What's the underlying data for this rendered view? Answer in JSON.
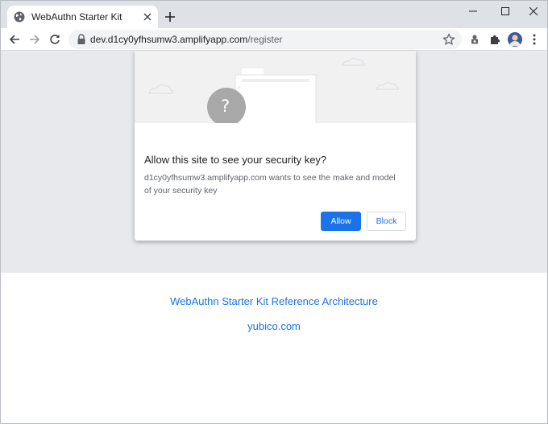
{
  "tab": {
    "title": "WebAuthn Starter Kit",
    "favicon": "globe-icon",
    "close_icon": "close-icon"
  },
  "new_tab_icon": "plus-icon",
  "window_controls": [
    "minimize-icon",
    "maximize-icon",
    "close-icon"
  ],
  "toolbar": {
    "back_icon": "arrow-left-icon",
    "forward_icon": "arrow-right-icon",
    "reload_icon": "reload-icon",
    "url_host": "dev.d1cy0yfhsumw3.amplifyapp.com",
    "url_path": "/register",
    "lock_icon": "lock-icon",
    "bookmark_icon": "star-icon",
    "extensions": [
      "puzzle-icon",
      "extension-icon"
    ],
    "menu_icon": "kebab-menu-icon"
  },
  "dialog": {
    "illustration_glyph": "?",
    "title": "Allow this site to see your security key?",
    "body": "d1cy0yfhsumw3.amplifyapp.com wants to see the make and model of your security key",
    "allow_label": "Allow",
    "block_label": "Block"
  },
  "footer": {
    "link1": "WebAuthn Starter Kit Reference Architecture",
    "link2": "yubico.com"
  },
  "colors": {
    "accent": "#1a73e8",
    "tabstrip": "#dee1e6",
    "page_band": "#e7e9ec"
  }
}
